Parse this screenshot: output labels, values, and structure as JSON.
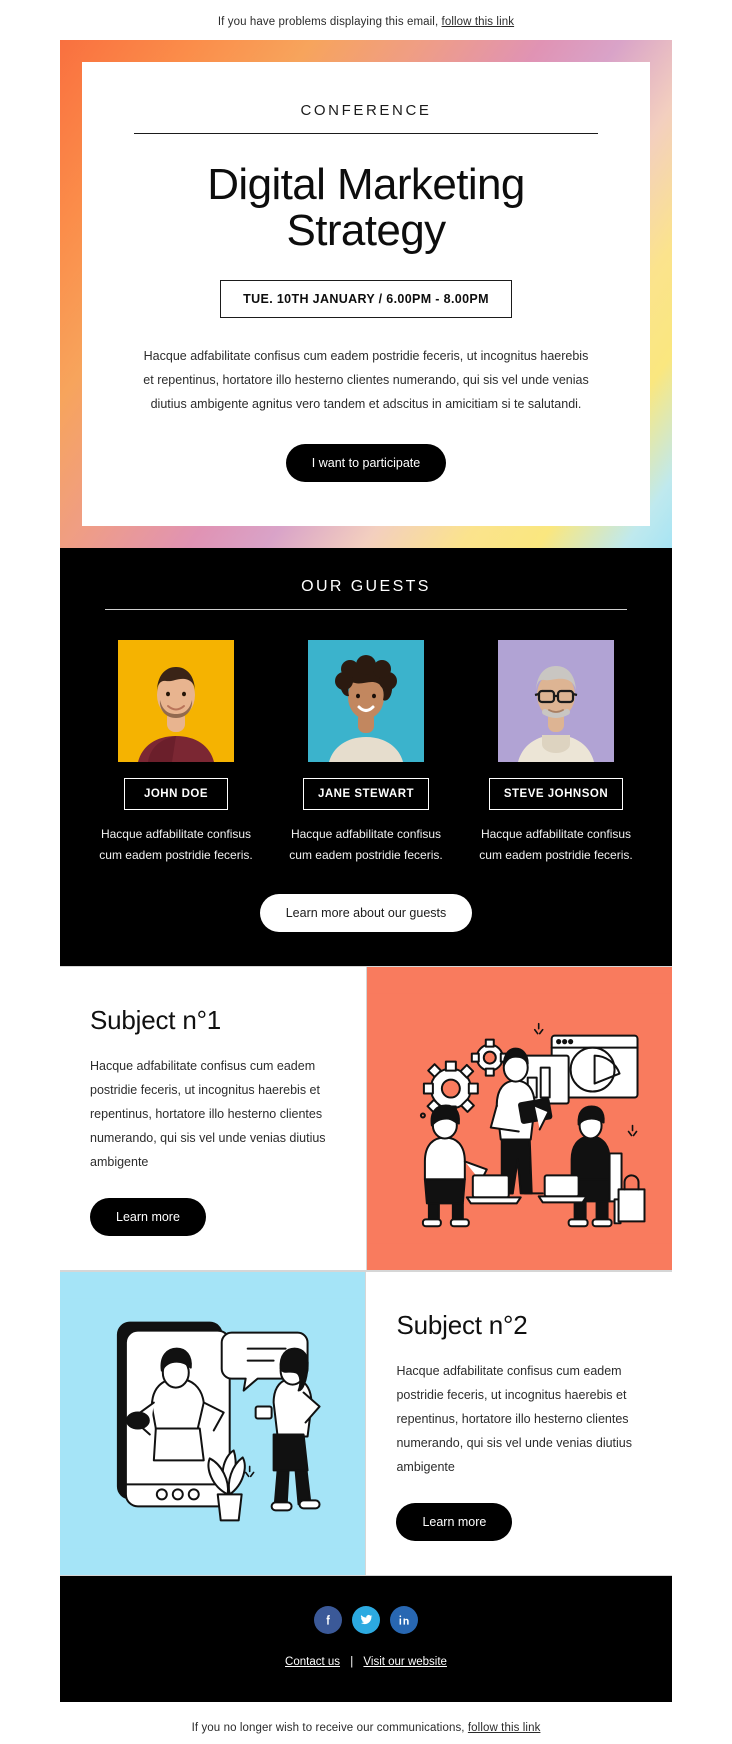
{
  "preheader": {
    "text": "If you have problems displaying this email,",
    "link": "follow this link"
  },
  "hero": {
    "kicker": "CONFERENCE",
    "title": "Digital Marketing Strategy",
    "date_badge": "TUE. 10TH JANUARY / 6.00PM - 8.00PM",
    "paragraph": "Hacque adfabilitate confisus cum eadem postridie feceris, ut incognitus haerebis et repentinus, hortatore illo hesterno clientes numerando, qui sis vel unde venias diutius ambigente agnitus vero tandem et adscitus in amicitiam si te salutandi.",
    "cta_label": "I want to participate"
  },
  "guests": {
    "title": "OUR GUESTS",
    "cta_label": "Learn more about our guests",
    "items": [
      {
        "name": "JOHN DOE",
        "description": "Hacque adfabilitate confisus cum eadem postridie feceris.",
        "bg_color": "#f5b301",
        "skin": "#e8b48f",
        "hair": "#3a2417",
        "clothes": "#7b2733"
      },
      {
        "name": "JANE STEWART",
        "description": "Hacque adfabilitate confisus cum eadem postridie feceris.",
        "bg_color": "#3bb3cc",
        "skin": "#c2875f",
        "hair": "#2b1a10",
        "clothes": "#e6ddcd"
      },
      {
        "name": "STEVE JOHNSON",
        "description": "Hacque adfabilitate confisus cum eadem postridie feceris.",
        "bg_color": "#b1a3d4",
        "skin": "#ddb493",
        "hair": "#c9c6c2",
        "clothes": "#ece5d6"
      }
    ]
  },
  "subjects": [
    {
      "title": "Subject n°1",
      "paragraph": "Hacque adfabilitate confisus cum eadem postridie feceris, ut incognitus haerebis et repentinus, hortatore illo hesterno clientes numerando, qui sis vel unde venias diutius ambigente",
      "cta_label": "Learn more",
      "art_color": "#f97b5e",
      "art_name": "teamwork-analytics-illustration"
    },
    {
      "title": "Subject n°2",
      "paragraph": "Hacque adfabilitate confisus cum eadem postridie feceris, ut incognitus haerebis et repentinus, hortatore illo hesterno clientes numerando, qui sis vel unde venias diutius ambigente",
      "cta_label": "Learn more",
      "art_color": "#a5e4f7",
      "art_name": "mobile-messaging-illustration"
    }
  ],
  "footer": {
    "socials": [
      {
        "name": "facebook",
        "glyph": "f",
        "color": "#3b5998"
      },
      {
        "name": "twitter",
        "glyph": "🐦",
        "color": "#2caae1"
      },
      {
        "name": "linkedin",
        "glyph": "in",
        "color": "#2867b2"
      }
    ],
    "contact_label": "Contact us",
    "separator": "|",
    "website_label": "Visit our website"
  },
  "unsubscribe": {
    "text": "If you no longer wish to receive our communications,",
    "link": "follow this link"
  }
}
